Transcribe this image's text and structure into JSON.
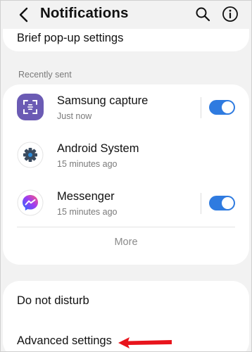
{
  "header": {
    "title": "Notifications",
    "back_icon": "back-arrow-icon",
    "search_icon": "search-icon",
    "info_icon": "info-icon"
  },
  "brief": {
    "label": "Brief pop-up settings"
  },
  "recent": {
    "section_label": "Recently sent",
    "apps": [
      {
        "name": "Samsung capture",
        "time": "Just now",
        "icon": "samsung-capture-icon",
        "toggle": true
      },
      {
        "name": "Android System",
        "time": "15 minutes ago",
        "icon": "android-system-icon",
        "toggle": null
      },
      {
        "name": "Messenger",
        "time": "15 minutes ago",
        "icon": "messenger-icon",
        "toggle": true
      }
    ],
    "more_label": "More"
  },
  "settings": {
    "do_not_disturb": "Do not disturb",
    "advanced": "Advanced settings"
  },
  "colors": {
    "accent": "#2f7be0",
    "annotation_arrow": "#e8141c",
    "capture_icon_bg": "#6b5bb4"
  }
}
